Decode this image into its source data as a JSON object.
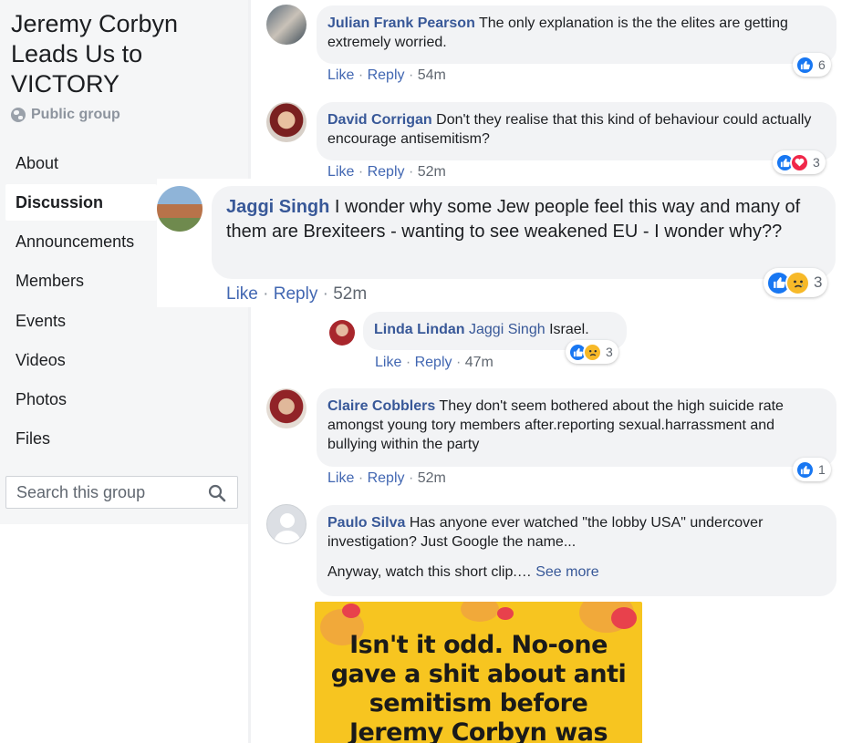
{
  "group": {
    "title": "Jeremy Corbyn Leads Us to VICTORY",
    "privacy": "Public group"
  },
  "nav": {
    "items": [
      "About",
      "Discussion",
      "Announcements",
      "Members",
      "Events",
      "Videos",
      "Photos",
      "Files"
    ],
    "active": "Discussion"
  },
  "search": {
    "placeholder": "Search this group"
  },
  "actions": {
    "like": "Like",
    "reply": "Reply",
    "sep": "·"
  },
  "comments": [
    {
      "author": "Julian Frank Pearson",
      "text": "The only explanation is the the elites are getting extremely worried.",
      "time": "54m",
      "reaction_count": "6"
    },
    {
      "author": "David Corrigan",
      "text": "Don't they realise that this kind of behaviour could actually encourage antisemitism?",
      "time": "52m",
      "reaction_count": "3"
    },
    {
      "author": "Jaggi Singh",
      "text": "I wonder why some Jew people feel this way and many of them are Brexiteers - wanting to see weakened EU - I wonder why??",
      "time": "52m",
      "reaction_count": "3"
    },
    {
      "author": "Linda Lindan",
      "mention": "Jaggi Singh",
      "text": "Israel.",
      "time": "47m",
      "reaction_count": "3"
    },
    {
      "author": "Claire Cobblers",
      "text": "They don't seem bothered about the high suicide rate amongst young tory members after.reporting sexual.harrassment and bullying within the party",
      "time": "52m",
      "reaction_count": "1"
    },
    {
      "author": "Paulo Silva",
      "text": "Has anyone ever watched \"the lobby USA\" undercover investigation? Just Google the name...",
      "text2": "Anyway, watch this short clip.…",
      "see_more": "See more"
    }
  ],
  "meme": {
    "lines": [
      "Isn't it odd. No-one",
      "gave a shit about anti",
      "semitism before",
      "Jeremy Corbyn was"
    ]
  },
  "colors": {
    "link": "#385898",
    "like_blue": "#1877f2",
    "love_red": "#f0284a",
    "sad_yellow": "#f7b928",
    "meme_bg": "#f7c520"
  }
}
